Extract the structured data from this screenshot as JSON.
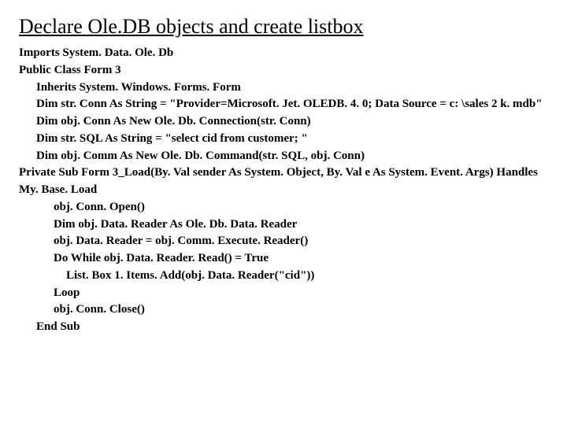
{
  "title": "Declare Ole.DB objects and create listbox",
  "lines": [
    {
      "cls": "noind",
      "text": "Imports System. Data. Ole. Db"
    },
    {
      "cls": "noind",
      "text": "Public Class Form 3"
    },
    {
      "cls": "ind1",
      "text": "Inherits System. Windows. Forms. Form"
    },
    {
      "cls": "ind1",
      "text": "Dim str. Conn As String = \"Provider=Microsoft. Jet. OLEDB. 4. 0; Data Source = c: \\sales 2 k. mdb\""
    },
    {
      "cls": "ind1",
      "text": "Dim obj. Conn As New Ole. Db. Connection(str. Conn)"
    },
    {
      "cls": "ind1",
      "text": "Dim str. SQL As String = \"select cid from customer; \""
    },
    {
      "cls": "ind1",
      "text": "Dim obj. Comm As New Ole. Db. Command(str. SQL, obj. Conn)"
    },
    {
      "cls": "noind",
      "text": "Private Sub Form 3_Load(By. Val sender As System. Object, By. Val e As System. Event. Args) Handles My. Base. Load"
    },
    {
      "cls": "ind2",
      "text": "obj. Conn. Open()"
    },
    {
      "cls": "ind2",
      "text": "Dim obj. Data. Reader As Ole. Db. Data. Reader"
    },
    {
      "cls": "ind2",
      "text": "obj. Data. Reader = obj. Comm. Execute. Reader()"
    },
    {
      "cls": "ind2",
      "text": "Do While obj. Data. Reader. Read() = True"
    },
    {
      "cls": "ind3",
      "text": "List. Box 1. Items. Add(obj. Data. Reader(\"cid\"))"
    },
    {
      "cls": "ind2",
      "text": "Loop"
    },
    {
      "cls": "ind2",
      "text": "obj. Conn. Close()"
    },
    {
      "cls": "ind1",
      "text": "End Sub"
    }
  ]
}
